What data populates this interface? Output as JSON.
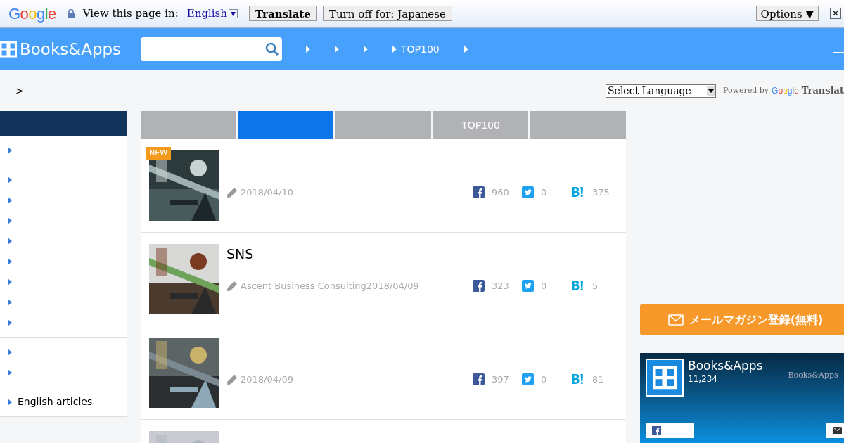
{
  "translate_bar": {
    "google_logo": "Google",
    "prompt": "View this page in:",
    "language": "English",
    "translate_button": "Translate",
    "turn_off_button": "Turn off for: Japanese",
    "options_button": "Options ▼",
    "close": "✕"
  },
  "header": {
    "logo": "Books&Apps",
    "nav": [
      {
        "kind": "blank"
      },
      {
        "kind": "blank"
      },
      {
        "kind": "blank"
      },
      {
        "kind": "text",
        "label": "TOP100"
      },
      {
        "kind": "blank"
      }
    ]
  },
  "breadcrumb": ">",
  "language_select": {
    "value": "Select Language",
    "google_logo": "Google",
    "powered_by": "Powered by",
    "brand": "Translat"
  },
  "sidebar": {
    "groups": [
      {
        "items": [
          {
            "kind": "blank"
          }
        ]
      },
      {
        "items": [
          {
            "kind": "blank"
          },
          {
            "kind": "blank"
          },
          {
            "kind": "blank"
          },
          {
            "kind": "blank"
          },
          {
            "kind": "blank"
          },
          {
            "kind": "blank"
          },
          {
            "kind": "blank"
          },
          {
            "kind": "blank"
          }
        ]
      },
      {
        "items": [
          {
            "kind": "blank"
          },
          {
            "kind": "blank"
          }
        ]
      },
      {
        "items": [
          {
            "kind": "text",
            "label": "English articles"
          }
        ]
      }
    ]
  },
  "tabs": [
    {
      "selected": false
    },
    {
      "selected": true
    },
    {
      "selected": false
    },
    {
      "label": "TOP100",
      "selected": false
    },
    {
      "selected": false
    }
  ],
  "articles": [
    {
      "kind": "article",
      "new_badge": "NEW",
      "date": "2018/04/10",
      "facebook": "960",
      "twitter": "0",
      "hatena": "375"
    },
    {
      "kind": "article",
      "title": "SNS",
      "author": "Ascent Business Consulting",
      "date": "2018/04/09",
      "facebook": "323",
      "twitter": "0",
      "hatena": "5"
    },
    {
      "kind": "article",
      "date": "2018/04/09",
      "facebook": "397",
      "twitter": "0",
      "hatena": "81"
    },
    {
      "kind": "picture"
    }
  ],
  "newsletter_button": "メールマガジン登録(無料)",
  "fb_widget": {
    "name": "Books&Apps",
    "likes": "11,234",
    "watermark": "Books&Apps"
  }
}
